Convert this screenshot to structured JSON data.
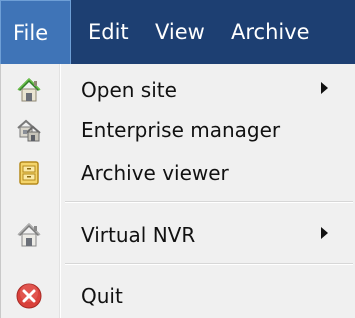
{
  "menubar": {
    "items": [
      {
        "label": "File",
        "open": true
      },
      {
        "label": "Edit"
      },
      {
        "label": "View"
      },
      {
        "label": "Archive"
      }
    ]
  },
  "file_menu": {
    "items": [
      {
        "label": "Open site",
        "icon": "home-icon",
        "submenu": true
      },
      {
        "label": "Enterprise manager",
        "icon": "enterprise-icon",
        "submenu": false
      },
      {
        "label": "Archive viewer",
        "icon": "archive-viewer-icon",
        "submenu": false
      },
      {
        "label": "Virtual NVR",
        "icon": "home-icon",
        "submenu": true
      },
      {
        "label": "Quit",
        "icon": "quit-icon",
        "submenu": false
      }
    ]
  },
  "colors": {
    "menubar_bg": "#1d3f72",
    "menubar_active": "#3f74b7",
    "menu_bg": "#f0f0f0",
    "quit_red": "#d9413b",
    "home_green": "#59a53a"
  }
}
